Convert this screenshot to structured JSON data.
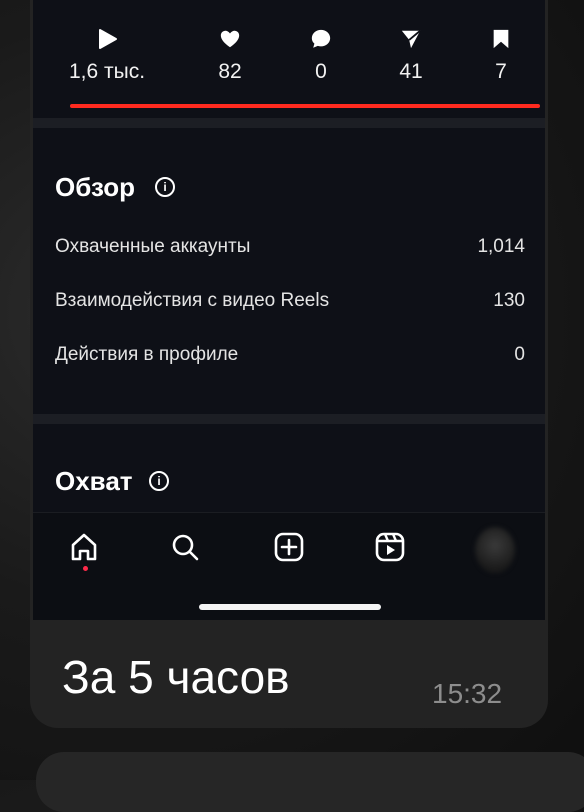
{
  "stats": [
    {
      "icon": "play-icon",
      "value": "1,6 тыс."
    },
    {
      "icon": "heart-icon",
      "value": "82"
    },
    {
      "icon": "comment-icon",
      "value": "0"
    },
    {
      "icon": "share-icon",
      "value": "41"
    },
    {
      "icon": "bookmark-icon",
      "value": "7"
    }
  ],
  "overview": {
    "title": "Обзор",
    "rows": [
      {
        "label": "Охваченные аккаунты",
        "value": "1,014"
      },
      {
        "label": "Взаимодействия с видео Reels",
        "value": "130"
      },
      {
        "label": "Действия в профиле",
        "value": "0"
      }
    ]
  },
  "reach": {
    "title": "Охват"
  },
  "tabbar": [
    "home-icon",
    "search-icon",
    "add-post-icon",
    "reels-icon",
    "profile-avatar"
  ],
  "message": {
    "text": "За 5 часов",
    "time": "15:32"
  },
  "colors": {
    "accent_underline": "#ff2a1f",
    "background": "#0e1017"
  }
}
